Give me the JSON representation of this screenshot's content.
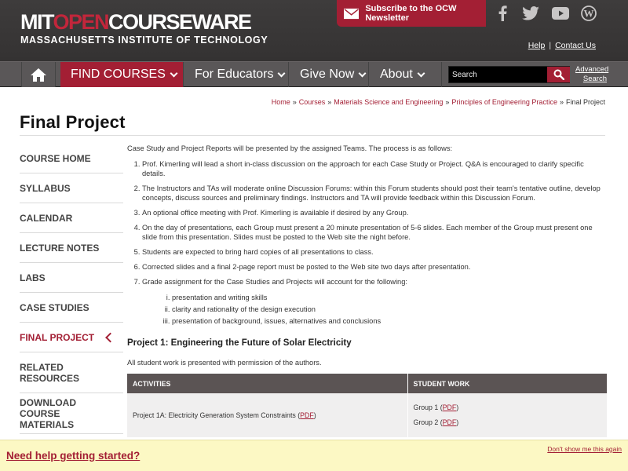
{
  "header": {
    "logo_main_white1": "MIT",
    "logo_main_red": "OPEN",
    "logo_main_white2": "COURSEWARE",
    "logo_sub": "MASSACHUSETTS INSTITUTE OF TECHNOLOGY",
    "newsletter_label": "Subscribe to the OCW Newsletter",
    "social_icons": [
      "facebook-icon",
      "twitter-icon",
      "youtube-icon",
      "wordpress-icon"
    ],
    "help_label": "Help",
    "contact_label": "Contact Us",
    "separator": "|"
  },
  "nav": {
    "items": [
      {
        "label": "FIND COURSES"
      },
      {
        "label": "For Educators"
      },
      {
        "label": "Give Now"
      },
      {
        "label": "About"
      }
    ],
    "search_placeholder": "Search",
    "advanced_search": "Advanced Search"
  },
  "breadcrumb": {
    "items": [
      "Home",
      "Courses",
      "Materials Science and Engineering",
      "Principles of Engineering Practice"
    ],
    "current": "Final Project",
    "sep": "»"
  },
  "page_title": "Final Project",
  "sidebar": {
    "items": [
      {
        "label": "Course Home"
      },
      {
        "label": "Syllabus"
      },
      {
        "label": "Calendar"
      },
      {
        "label": "Lecture Notes"
      },
      {
        "label": "Labs"
      },
      {
        "label": "Case Studies"
      },
      {
        "label": "Final Project"
      },
      {
        "label": "Related Resources"
      },
      {
        "label": "Download Course Materials"
      }
    ]
  },
  "main": {
    "intro": "Case Study and Project Reports will be presented by the assigned Teams. The process is as follows:",
    "steps": [
      "Prof. Kimerling will lead a short in-class discussion on the approach for each Case Study or Project. Q&A is encouraged to clarify specific details.",
      "The Instructors and TAs will moderate online Discussion Forums: within this Forum students should post their team's tentative outline, develop concepts, discuss sources and preliminary findings. Instructors and TA will provide feedback within this Discussion Forum.",
      "An optional office meeting with Prof. Kimerling is available if desired by any Group.",
      "On the day of presentations, each Group must present a 20 minute presentation of 5-6 slides. Each member of the Group must present one slide from this presentation. Slides must be posted to the Web site the night before.",
      "Students are expected to bring hard copies of all presentations to class.",
      "Corrected slides and a final 2-page report must be posted to the Web site two days after presentation.",
      "Grade assignment for the Case Studies and Projects will account for the following:"
    ],
    "grading": [
      "presentation and writing skills",
      "clarity and rationality of the design execution",
      "presentation of background, issues, alternatives and conclusions"
    ],
    "project_title": "Project 1: Engineering the Future of Solar Electricity",
    "permission": "All student work is presented with permission of the authors.",
    "table": {
      "headers": [
        "ACTIVITIES",
        "STUDENT WORK"
      ],
      "row1_activity": "Project 1A: Electricity Generation System Constraints (",
      "row1_activity_link": "PDF",
      "row1_activity_end": ")",
      "groups": [
        {
          "label": "Group 1 (",
          "link": "PDF",
          "end": ")"
        },
        {
          "label": "Group 2 (",
          "link": "PDF",
          "end": ")"
        }
      ]
    }
  },
  "help_bar": {
    "link": "Need help getting started?",
    "dismiss": "Don't show me this again"
  },
  "colors": {
    "brand_red": "#a31f34",
    "header_bg": "#3b3b3b",
    "nav_bg": "#5a5758",
    "help_bg": "#fcf8c4"
  }
}
